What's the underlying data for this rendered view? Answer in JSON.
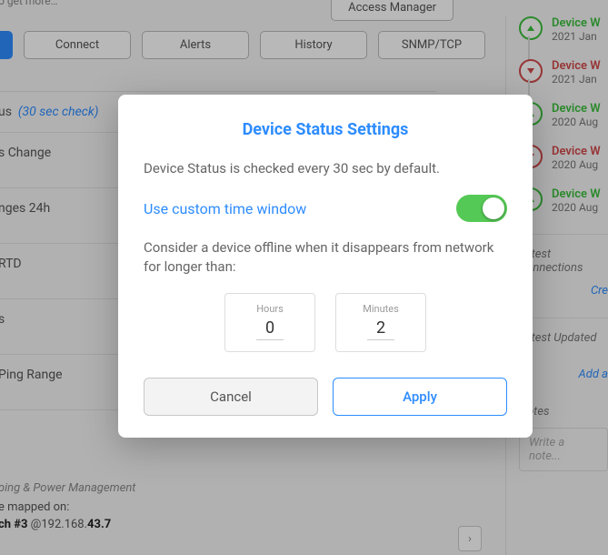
{
  "top": {
    "hint": "… services to get more…",
    "access_btn": "Access Manager"
  },
  "tabs": [
    "",
    "Connect",
    "Alerts",
    "History",
    "SNMP/TCP"
  ],
  "rows": {
    "status_label": "us",
    "status_hint": "(30 sec check)",
    "change": "s Change",
    "changes24": "nges 24h",
    "rtd": " RTD",
    "s": "s",
    "ping": "Ping Range",
    "blank": ""
  },
  "ping_section": "ping & Power Management",
  "mapped_pre": "e mapped on:",
  "mapped_main_a": "ch #3",
  "mapped_main_b": " @192.168.",
  "mapped_main_c": "43.7",
  "events": [
    {
      "dir": "up",
      "title": "Device W",
      "date": "2021 Jan"
    },
    {
      "dir": "dn",
      "title": "Device W",
      "date": "2021 Jan"
    },
    {
      "dir": "up",
      "title": "Device W",
      "date": "2020 Aug"
    },
    {
      "dir": "dn",
      "title": "Device W",
      "date": "2020 Aug"
    },
    {
      "dir": "up",
      "title": "Device W",
      "date": "2020 Aug"
    }
  ],
  "right": {
    "latest_conn": "Latest Connections",
    "create": "Cre",
    "latest_upd": "Latest Updated Se",
    "add": "Add a",
    "notes": "Notes",
    "note_ph": "Write a note..."
  },
  "modal": {
    "title": "Device Status Settings",
    "intro": "Device Status is checked every 30 sec by default.",
    "toggle_label": "Use custom time window",
    "desc": "Consider a device offline when it disappears from network for longer than:",
    "hours_label": "Hours",
    "hours_value": "0",
    "minutes_label": "Minutes",
    "minutes_value": "2",
    "cancel": "Cancel",
    "apply": "Apply"
  }
}
